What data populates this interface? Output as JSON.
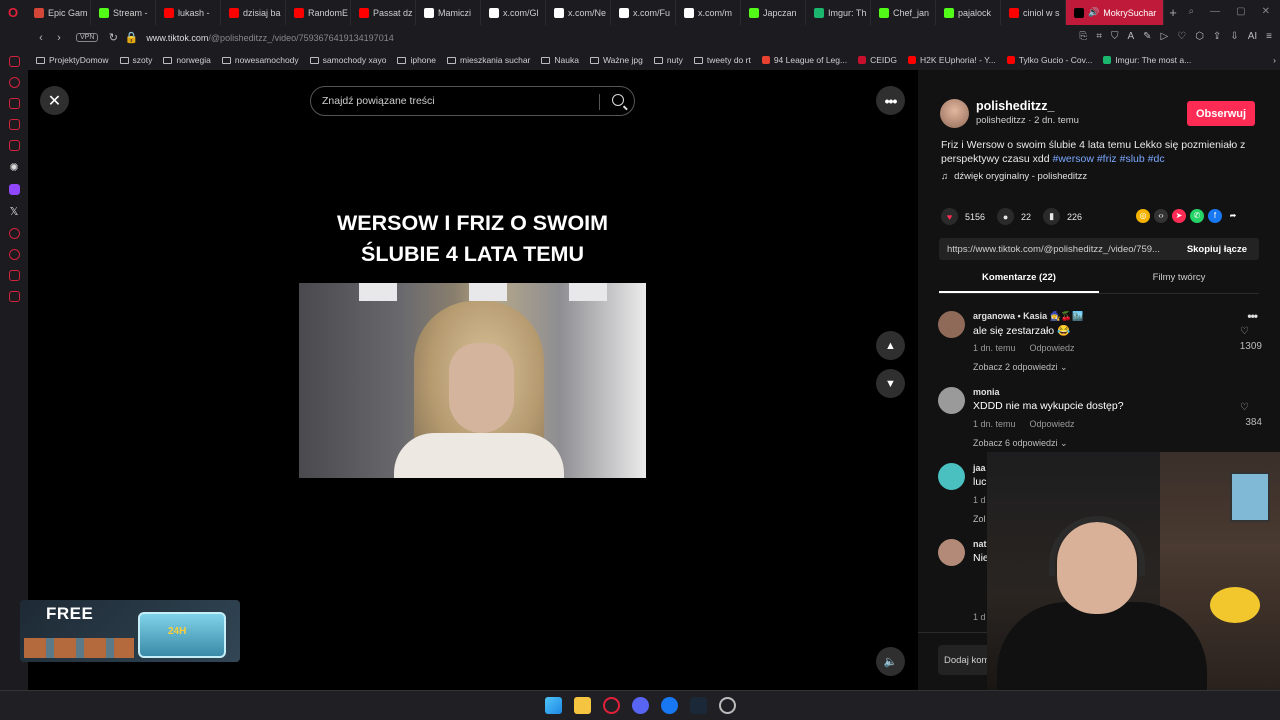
{
  "browser": {
    "tabs": [
      {
        "label": "Epic Gam",
        "color": "#d44638"
      },
      {
        "label": "Stream -",
        "color": "#53fc18"
      },
      {
        "label": "lukash -",
        "color": "#ff0000"
      },
      {
        "label": "dzisiaj ba",
        "color": "#ff0000"
      },
      {
        "label": "RandomE",
        "color": "#ff0000"
      },
      {
        "label": "Passat dz",
        "color": "#ff0000"
      },
      {
        "label": "Mamiczi",
        "color": "#ffffff"
      },
      {
        "label": "x.com/Gl",
        "color": "#ffffff"
      },
      {
        "label": "x.com/Ne",
        "color": "#ffffff"
      },
      {
        "label": "x.com/Fu",
        "color": "#ffffff"
      },
      {
        "label": "x.com/m",
        "color": "#ffffff"
      },
      {
        "label": "Japczan",
        "color": "#53fc18"
      },
      {
        "label": "Imgur: Th",
        "color": "#1bb76e"
      },
      {
        "label": "Chef_jan",
        "color": "#53fc18"
      },
      {
        "label": "pajalock",
        "color": "#53fc18"
      },
      {
        "label": "ciniol w s",
        "color": "#ff0000"
      }
    ],
    "active_tab": "MokrySuchar",
    "url_prefix": "www.tiktok.com",
    "url_path": "/@polisheditzz_/video/7593676419134197014",
    "vpn_label": "VPN",
    "ai_label": "AI"
  },
  "bookmarks": [
    {
      "label": "ProjektyDomow",
      "type": "folder"
    },
    {
      "label": "szoty",
      "type": "folder"
    },
    {
      "label": "norwegia",
      "type": "folder"
    },
    {
      "label": "nowesamochody",
      "type": "folder"
    },
    {
      "label": "samochody xayo",
      "type": "folder"
    },
    {
      "label": "iphone",
      "type": "folder"
    },
    {
      "label": "mieszkania suchar",
      "type": "folder"
    },
    {
      "label": "Nauka",
      "type": "folder"
    },
    {
      "label": "Ważne jpg",
      "type": "folder"
    },
    {
      "label": "nuty",
      "type": "folder"
    },
    {
      "label": "tweety do rt",
      "type": "folder"
    },
    {
      "label": "94 League of Leg...",
      "type": "site"
    },
    {
      "label": "CEIDG",
      "type": "site"
    },
    {
      "label": "H2K EUphoria! - Y...",
      "type": "site"
    },
    {
      "label": "Tylko Gucio - Cov...",
      "type": "site"
    },
    {
      "label": "Imgur: The most a...",
      "type": "site"
    }
  ],
  "search": {
    "placeholder": "Znajdź powiązane treści"
  },
  "video": {
    "title_line1": "WERSOW I FRIZ O SWOIM",
    "title_line2": "ŚLUBIE 4 LATA TEMU"
  },
  "promo": {
    "free_label": "FREE",
    "chest_label": "24H"
  },
  "post": {
    "username": "polisheditzz_",
    "subline": "polisheditzz · 2 dn. temu",
    "follow_label": "Obserwuj",
    "description": "Friz i Wersow o swoim ślubie 4 lata temu Lekko się pozmieniało z perspektywy czasu xdd",
    "hashtags": [
      "#wersow",
      "#friz",
      "#slub",
      "#dc"
    ],
    "sound": "dźwięk oryginalny - polisheditzz",
    "likes": "5156",
    "comments": "22",
    "saves": "226",
    "link": "https://www.tiktok.com/@polisheditzz_/video/759...",
    "copy_label": "Skopiuj łącze"
  },
  "panel_tabs": {
    "comments": "Komentarze (22)",
    "creator": "Filmy twórcy"
  },
  "comments": [
    {
      "user": "arganowa • Kasia 🧙‍♀️🍒🏙️",
      "text": "ale się zestarzało 😂",
      "time": "1 dn. temu",
      "reply": "Odpowiedz",
      "replies": "Zobacz 2 odpowiedzi ⌄",
      "likes": "1309",
      "avatar": "#8f6a58"
    },
    {
      "user": "monia",
      "text": "XDDD nie ma wykupcie dostęp?",
      "time": "1 dn. temu",
      "reply": "Odpowiedz",
      "replies": "Zobacz 6 odpowiedzi ⌄",
      "likes": "384",
      "avatar": "#9a9a9a"
    },
    {
      "user": "jaa",
      "text": "luc",
      "time": "1 d",
      "reply": "",
      "replies": "Zol",
      "likes": "",
      "avatar": "#4ac0c0"
    },
    {
      "user": "nat",
      "text": "Nie",
      "time": "1 d",
      "reply": "",
      "replies": "",
      "likes": "",
      "avatar": "#b38a78"
    }
  ],
  "add_comment": {
    "placeholder": "Dodaj kom"
  }
}
